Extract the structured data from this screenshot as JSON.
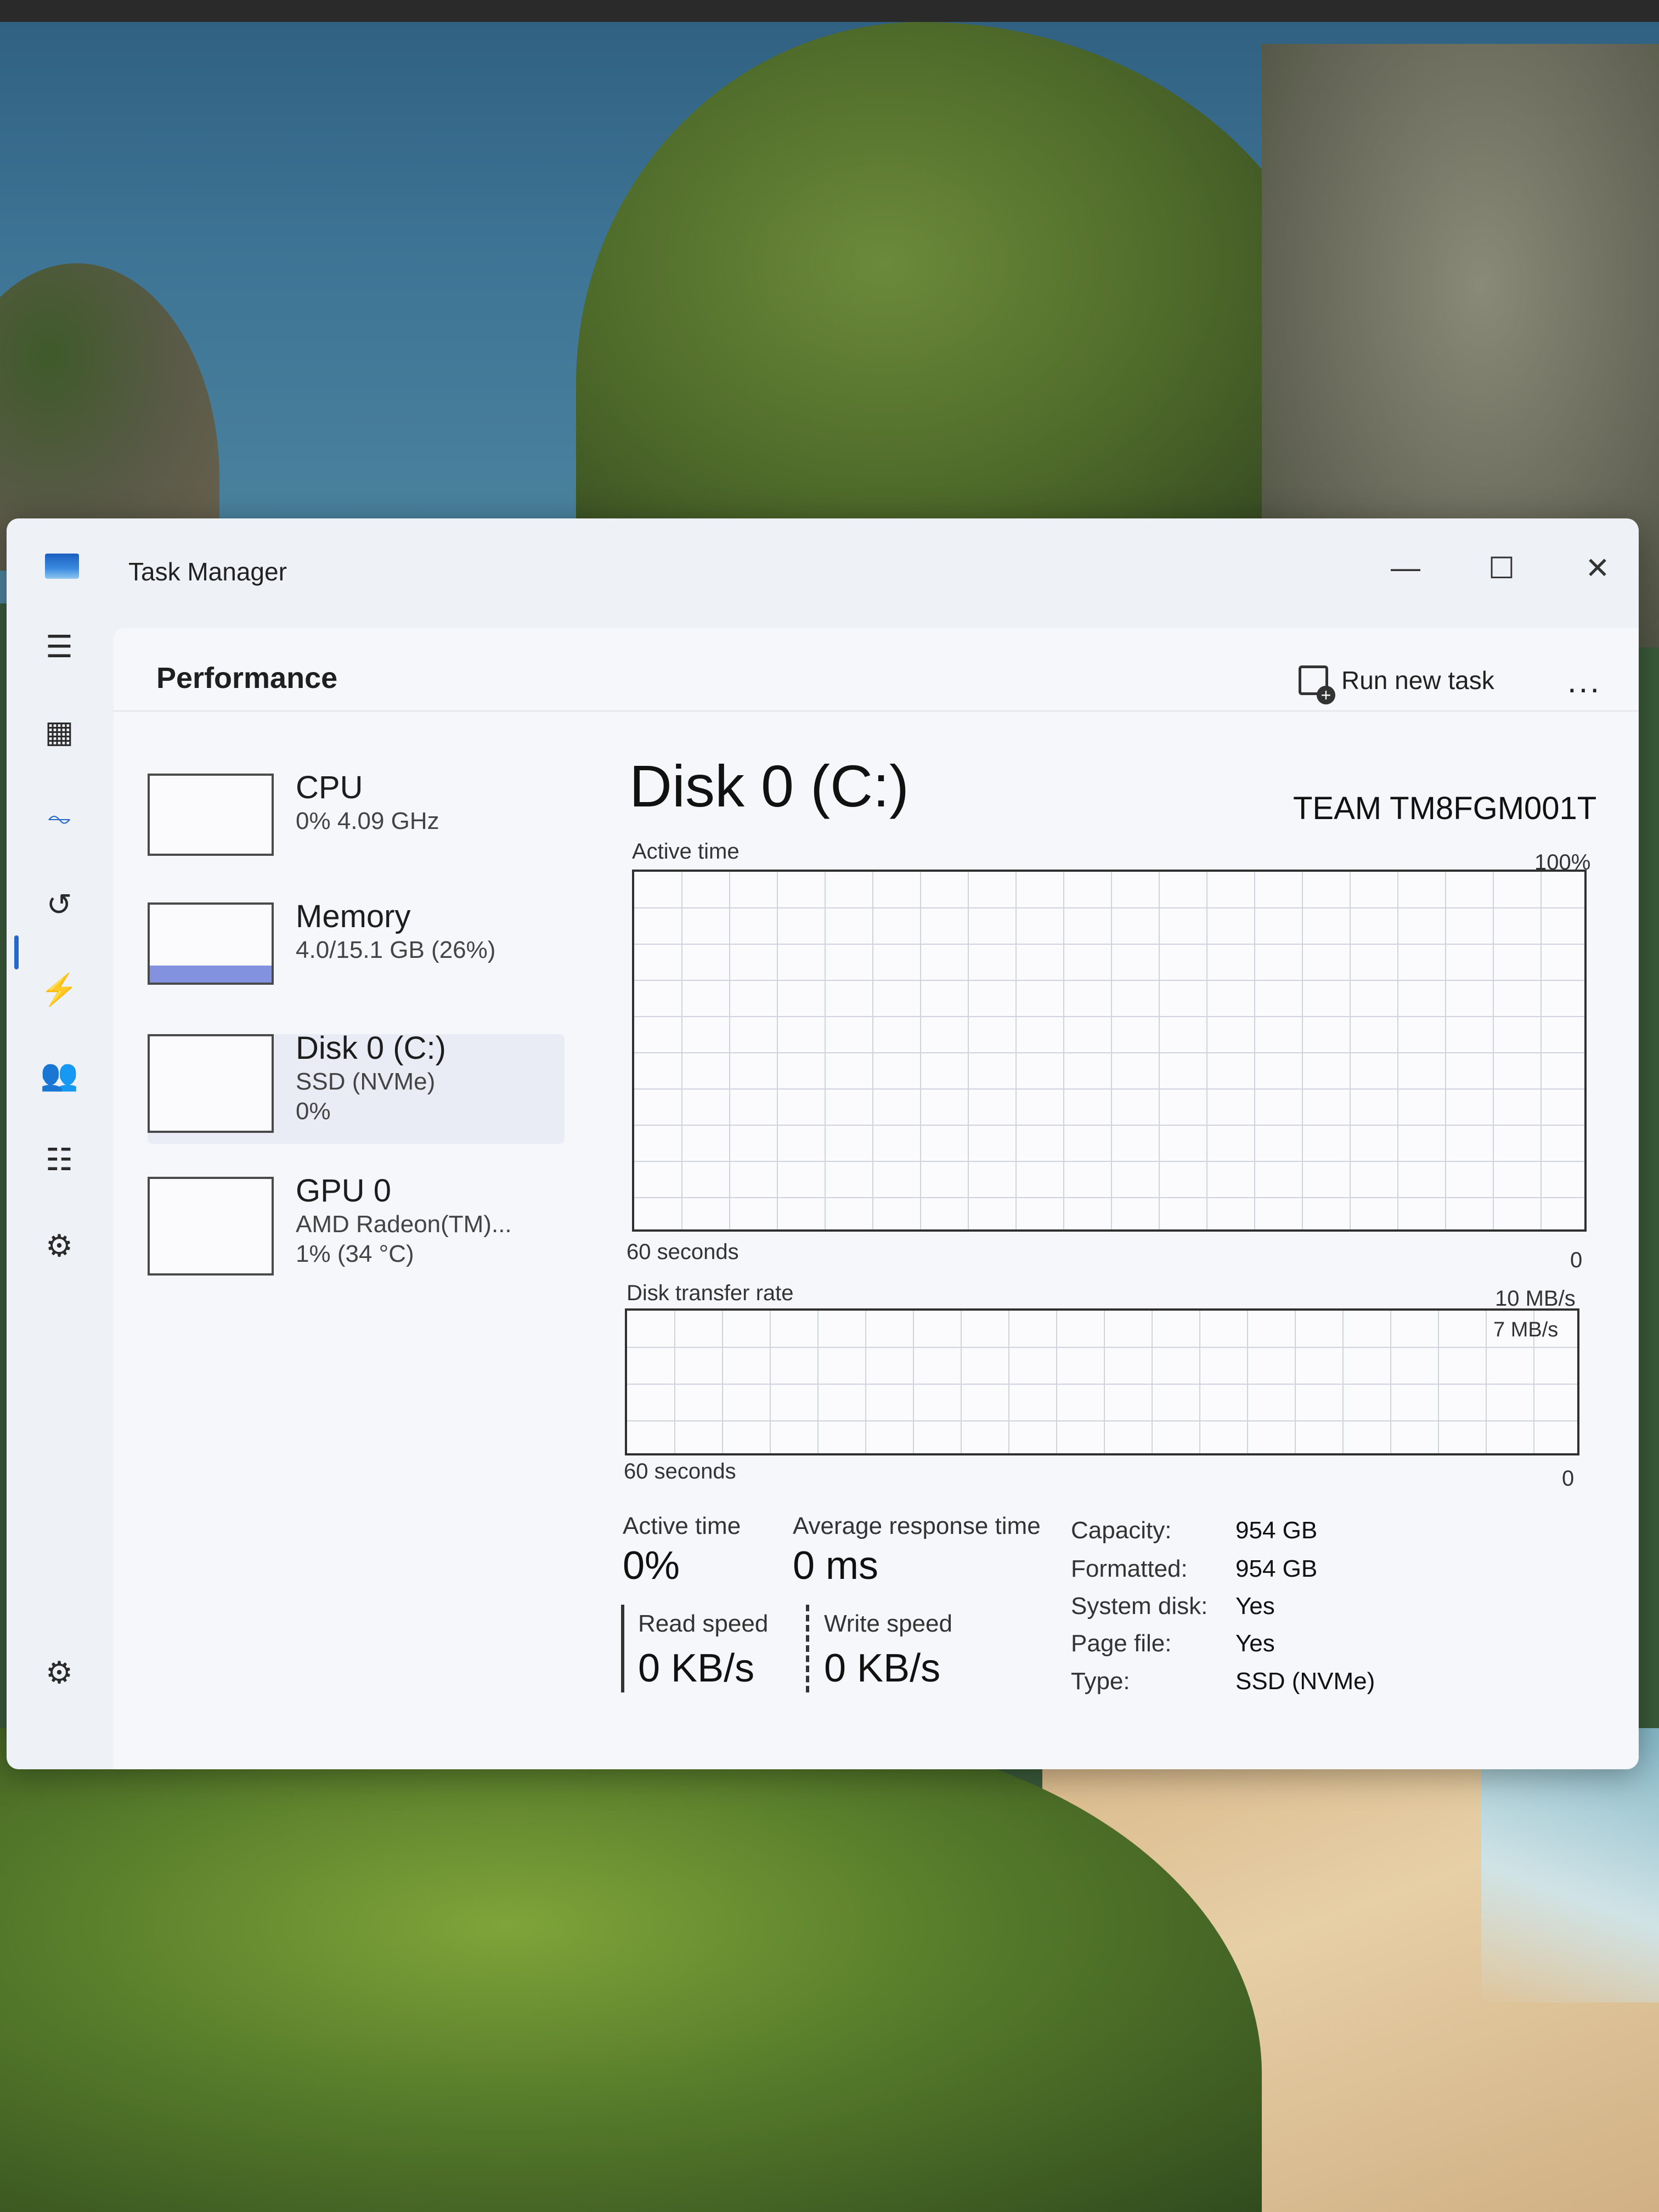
{
  "window": {
    "title": "Task Manager",
    "minimize": "—",
    "maximize": "☐",
    "close": "✕"
  },
  "header": {
    "title": "Performance",
    "run_new_task": "Run new task",
    "more": "..."
  },
  "nav": {
    "items": [
      {
        "name": "menu-icon",
        "glyph": "☰"
      },
      {
        "name": "processes-icon",
        "glyph": "▦"
      },
      {
        "name": "performance-icon",
        "glyph": "⏦"
      },
      {
        "name": "app-history-icon",
        "glyph": "↺"
      },
      {
        "name": "startup-apps-icon",
        "glyph": "⚡"
      },
      {
        "name": "users-icon",
        "glyph": "👥"
      },
      {
        "name": "details-icon",
        "glyph": "☷"
      },
      {
        "name": "services-icon",
        "glyph": "⚙"
      }
    ],
    "settings_glyph": "⚙"
  },
  "devices": [
    {
      "name": "CPU",
      "sub": "0% 4.09 GHz",
      "sub2": ""
    },
    {
      "name": "Memory",
      "sub": "4.0/15.1 GB (26%)",
      "sub2": ""
    },
    {
      "name": "Disk 0 (C:)",
      "sub": "SSD (NVMe)",
      "sub2": "0%"
    },
    {
      "name": "GPU 0",
      "sub": "AMD Radeon(TM)...",
      "sub2": "1% (34 °C)"
    }
  ],
  "main": {
    "title": "Disk 0 (C:)",
    "model": "TEAM TM8FGM001T",
    "active_time_chart": {
      "label": "Active time",
      "max": "100%",
      "x_label": "60 seconds",
      "min": "0"
    },
    "transfer_chart": {
      "label": "Disk transfer rate",
      "max": "10 MB/s",
      "marker": "7 MB/s",
      "x_label": "60 seconds",
      "min": "0"
    },
    "stats": {
      "active_time_label": "Active time",
      "active_time_value": "0%",
      "avg_resp_label": "Average response time",
      "avg_resp_value": "0 ms",
      "read_label": "Read speed",
      "read_value": "0 KB/s",
      "write_label": "Write speed",
      "write_value": "0 KB/s"
    },
    "info": [
      {
        "k": "Capacity:",
        "v": "954 GB"
      },
      {
        "k": "Formatted:",
        "v": "954 GB"
      },
      {
        "k": "System disk:",
        "v": "Yes"
      },
      {
        "k": "Page file:",
        "v": "Yes"
      },
      {
        "k": "Type:",
        "v": "SSD (NVMe)"
      }
    ]
  },
  "colors": {
    "accent": "#2566c9",
    "memory_fill": "#6d7fd8",
    "graph_line": "#3a7a3a"
  }
}
